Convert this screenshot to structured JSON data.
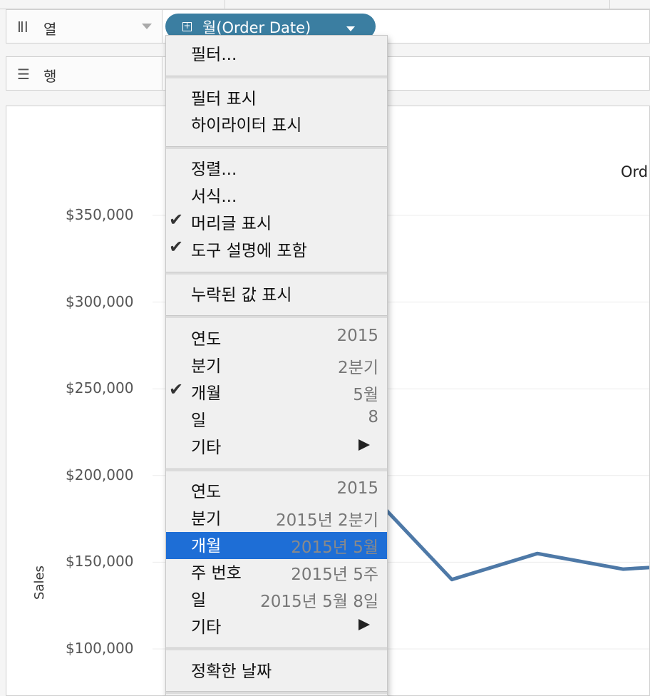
{
  "shelves": {
    "columns": {
      "icon": "columns-icon",
      "label": "열",
      "pill": "월(Order Date)"
    },
    "rows": {
      "icon": "rows-icon",
      "label": "행"
    }
  },
  "view": {
    "header": "Ord",
    "y_axis_title": "Sales",
    "y_ticks": [
      "$350,000",
      "$300,000",
      "$250,000",
      "$200,000",
      "$150,000",
      "$100,000"
    ]
  },
  "menu": {
    "filter": "필터...",
    "show_filter": "필터 표시",
    "show_highlighter": "하이라이터 표시",
    "sort": "정렬...",
    "format": "서식...",
    "show_header": "머리글 표시",
    "include_tooltip": "도구 설명에 포함",
    "show_missing": "누락된 값 표시",
    "discrete": [
      {
        "label": "연도",
        "value": "2015"
      },
      {
        "label": "분기",
        "value": "2분기"
      },
      {
        "label": "개월",
        "value": "5월",
        "checked": true
      },
      {
        "label": "일",
        "value": "8"
      },
      {
        "label": "기타",
        "submenu": true
      }
    ],
    "continuous": [
      {
        "label": "연도",
        "value": "2015"
      },
      {
        "label": "분기",
        "value": "2015년 2분기"
      },
      {
        "label": "개월",
        "value": "2015년 5월",
        "highlighted": true
      },
      {
        "label": "주 번호",
        "value": "2015년 5주"
      },
      {
        "label": "일",
        "value": "2015년 5월 8일"
      },
      {
        "label": "기타",
        "submenu": true
      }
    ],
    "exact_date": "정확한 날짜",
    "check_icon": "checkmark-icon",
    "submenu_icon": "submenu-arrow-icon"
  },
  "colors": {
    "pill": "#3b7ea1",
    "line": "#4e79a7",
    "highlight": "#1e6ed6"
  },
  "chart_data": {
    "type": "line",
    "title": "",
    "xlabel": "",
    "ylabel": "Sales",
    "y_ticks": [
      100000,
      150000,
      200000,
      250000,
      300000,
      350000
    ],
    "series": [
      {
        "values": [
          190000,
          140000,
          155000,
          146000,
          147000
        ]
      }
    ]
  }
}
